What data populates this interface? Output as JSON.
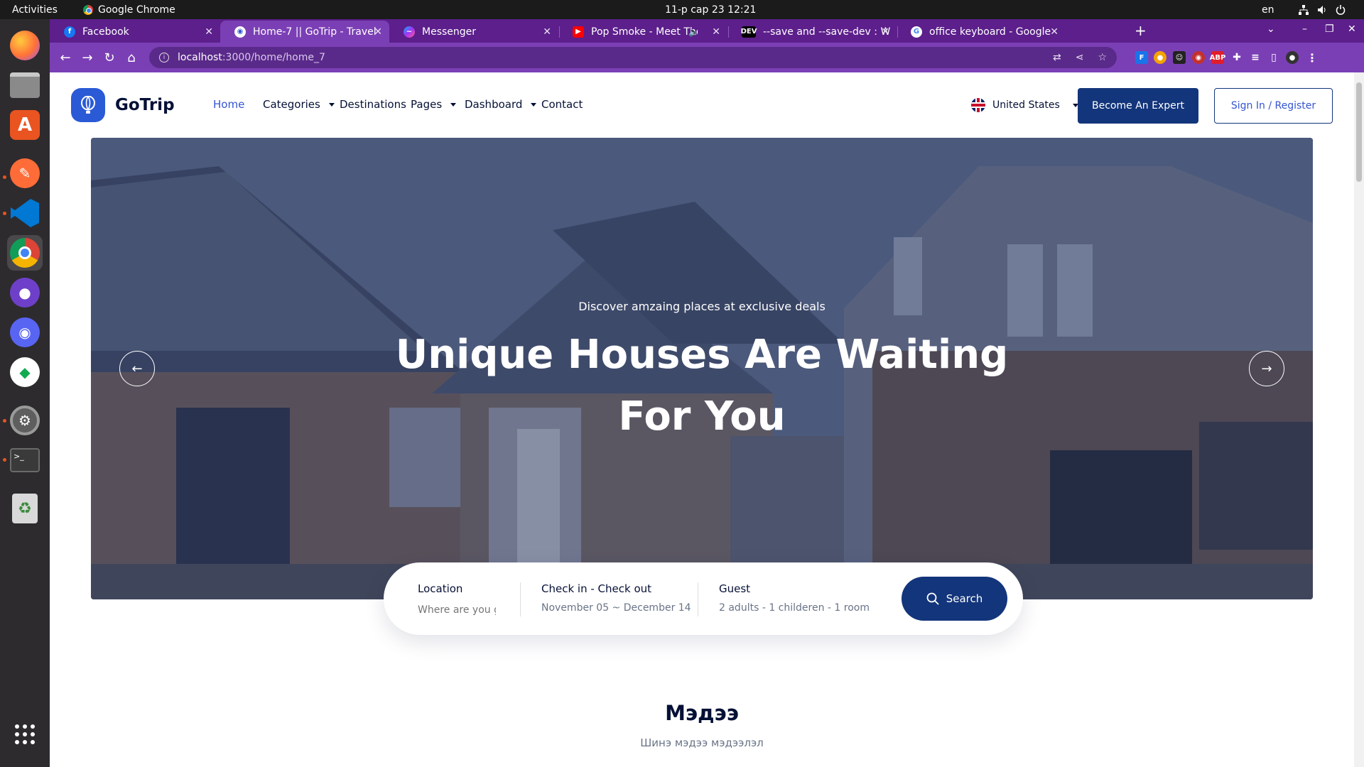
{
  "system": {
    "activities": "Activities",
    "app_name": "Google Chrome",
    "clock": "11-р сар 23  12:21",
    "lang": "en"
  },
  "tabs": [
    {
      "title": "Facebook",
      "favicon": "facebook-icon",
      "color": "#1877f2"
    },
    {
      "title": "Home-7 || GoTrip - Travel",
      "favicon": "gotrip-icon",
      "color": "#ffffff",
      "active": true
    },
    {
      "title": "Messenger",
      "favicon": "messenger-icon",
      "color": "#a334fa"
    },
    {
      "title": "Pop Smoke - Meet The",
      "favicon": "youtube-icon",
      "color": "#ff0000"
    },
    {
      "title": "--save and --save-dev : Wh",
      "favicon": "dev-icon",
      "color": "#000000"
    },
    {
      "title": "office keyboard - Google",
      "favicon": "google-icon",
      "color": "#ffffff"
    }
  ],
  "omnibox": {
    "host": "localhost",
    "path": ":3000/home/home_7"
  },
  "site": {
    "logo_text": "GoTrip",
    "nav": [
      {
        "label": "Home",
        "active": true,
        "dropdown": false
      },
      {
        "label": "Categories",
        "dropdown": true
      },
      {
        "label": "Destinations",
        "dropdown": false
      },
      {
        "label": "Pages",
        "dropdown": true
      },
      {
        "label": "Dashboard",
        "dropdown": true
      },
      {
        "label": "Contact",
        "dropdown": false
      }
    ],
    "country": "United States",
    "become_expert": "Become An Expert",
    "sign_in": "Sign In / Register"
  },
  "hero": {
    "subtitle": "Discover amzaing places at exclusive deals",
    "title_line1": "Unique Houses Are Waiting",
    "title_line2": "For You"
  },
  "search": {
    "location_label": "Location",
    "location_placeholder": "Where are you g",
    "dates_label": "Check in - Check out",
    "dates_value": "November 05 ~ December 14",
    "guest_label": "Guest",
    "guest_value": "2 adults - 1 childeren - 1 room",
    "button": "Search"
  },
  "section": {
    "title": "Мэдээ",
    "subtitle": "Шинэ мэдээ мэдээлэл"
  },
  "colors": {
    "primary": "#13357b",
    "accent": "#3554d1",
    "text": "#051036",
    "tab_strip": "#5c1f8b",
    "toolbar": "#7b3fb5"
  }
}
